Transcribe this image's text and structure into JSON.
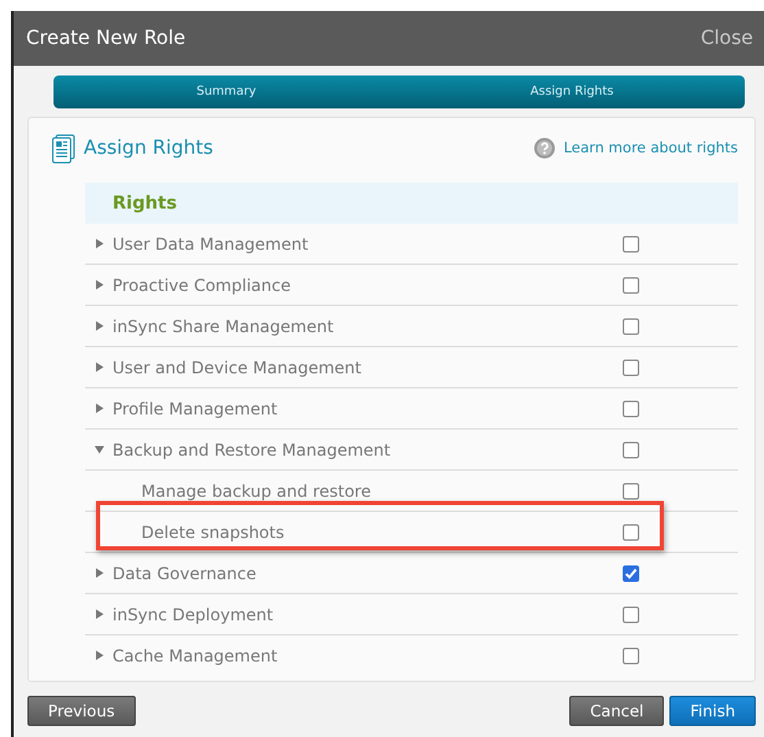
{
  "window": {
    "title": "Create New Role",
    "close": "Close"
  },
  "steps": [
    {
      "label": "Summary"
    },
    {
      "label": "Assign Rights"
    }
  ],
  "panel": {
    "title": "Assign Rights",
    "help_link": "Learn more about rights"
  },
  "rights": {
    "heading": "Rights",
    "rows": [
      {
        "label": "User Data Management",
        "expanded": false,
        "checked": false
      },
      {
        "label": "Proactive Compliance",
        "expanded": false,
        "checked": false
      },
      {
        "label": "inSync Share Management",
        "expanded": false,
        "checked": false
      },
      {
        "label": "User and Device Management",
        "expanded": false,
        "checked": false
      },
      {
        "label": "Profile Management",
        "expanded": false,
        "checked": false
      },
      {
        "label": "Backup and Restore Management",
        "expanded": true,
        "checked": false,
        "children": [
          {
            "label": "Manage backup and restore",
            "checked": false,
            "highlighted": false
          },
          {
            "label": "Delete snapshots",
            "checked": false,
            "highlighted": true
          }
        ]
      },
      {
        "label": "Data Governance",
        "expanded": false,
        "checked": true
      },
      {
        "label": "inSync Deployment",
        "expanded": false,
        "checked": false
      },
      {
        "label": "Cache Management",
        "expanded": false,
        "checked": false
      }
    ]
  },
  "buttons": {
    "previous": "Previous",
    "cancel": "Cancel",
    "finish": "Finish"
  }
}
